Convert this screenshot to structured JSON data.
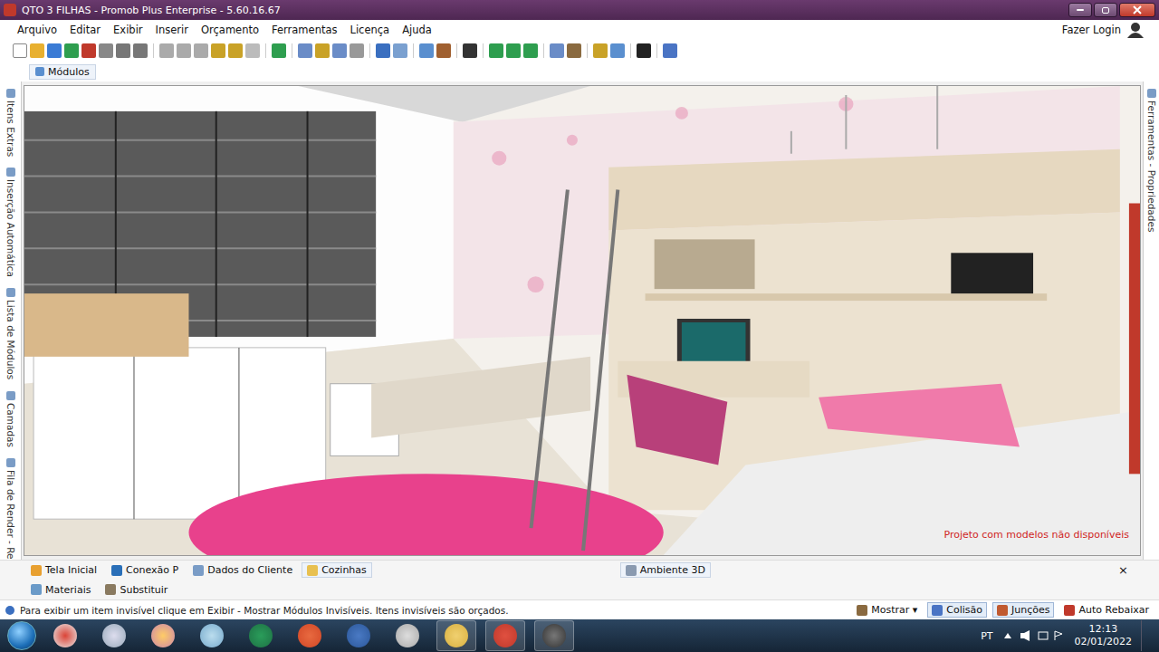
{
  "window": {
    "title": "QTO 3 FILHAS - Promob Plus Enterprise - 5.60.16.67"
  },
  "menu": [
    "Arquivo",
    "Editar",
    "Exibir",
    "Inserir",
    "Orçamento",
    "Ferramentas",
    "Licença",
    "Ajuda"
  ],
  "login": "Fazer Login",
  "module_tab": "Módulos",
  "left_panels": [
    "Itens Extras",
    "Inserção Automática",
    "Lista de Módulos",
    "Camadas",
    "Fila de Render - Real Scene"
  ],
  "right_panels": [
    "Ferramentas - Propriedades"
  ],
  "viewport": {
    "watermark": "Projeto com modelos não disponíveis"
  },
  "bottom_tabs": [
    {
      "label": "Tela Inicial",
      "selected": false
    },
    {
      "label": "Conexão P",
      "selected": false
    },
    {
      "label": "Dados do Cliente",
      "selected": false
    },
    {
      "label": "Cozinhas",
      "selected": true
    }
  ],
  "document_tab": {
    "label": "Ambiente 3D",
    "close": "×"
  },
  "lower_tabs": [
    "Materiais",
    "Substituir"
  ],
  "status_bar": {
    "message": "Para exibir um item invisível clique em Exibir - Mostrar Módulos Invisíveis. Itens invisíveis são orçados.",
    "buttons": [
      {
        "label": "Mostrar ▾",
        "on": false
      },
      {
        "label": "Colisão",
        "on": true
      },
      {
        "label": "Junções",
        "on": true
      },
      {
        "label": "Auto Rebaixar",
        "on": false
      }
    ]
  },
  "taskbar": {
    "language": "PT",
    "time": "12:13",
    "date": "02/01/2022"
  }
}
